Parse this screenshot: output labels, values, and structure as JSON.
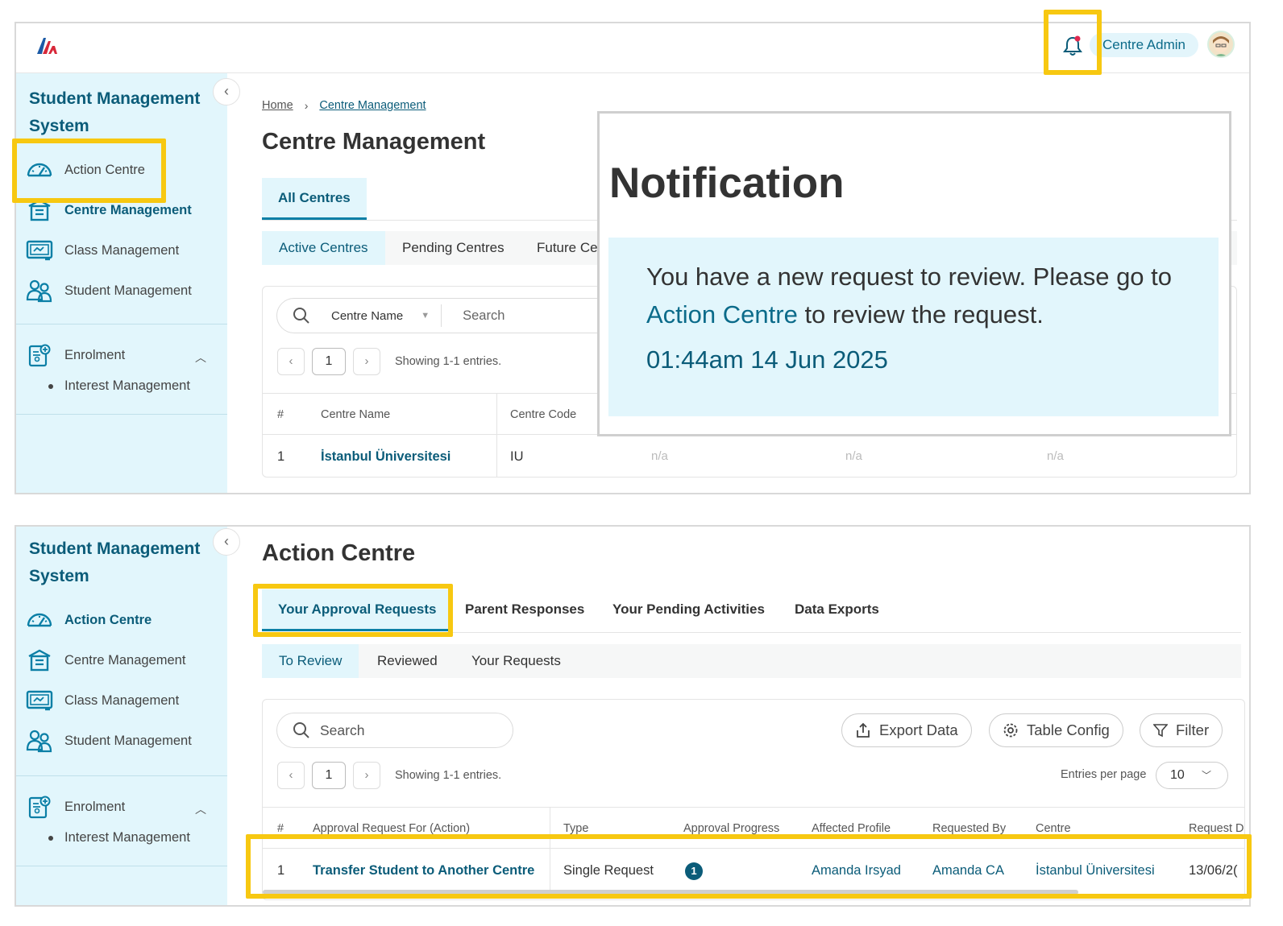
{
  "colors": {
    "brand": "#0b5c79",
    "sidebar_bg": "#e2f6fc",
    "highlight": "#f7c811",
    "notification_dot": "#e0284f"
  },
  "top": {
    "header": {
      "user_name": "Centre Admin"
    },
    "sidebar": {
      "title": "Student Management System",
      "items": [
        {
          "label": "Action Centre",
          "icon": "gauge-icon"
        },
        {
          "label": "Centre Management",
          "icon": "building-icon"
        },
        {
          "label": "Class Management",
          "icon": "classroom-icon"
        },
        {
          "label": "Student Management",
          "icon": "students-icon"
        }
      ],
      "enrolment": {
        "label": "Enrolment",
        "sub_items": [
          "Interest Management"
        ]
      }
    },
    "breadcrumb": [
      "Home",
      "Centre Management"
    ],
    "page_title": "Centre Management",
    "tabs": [
      "All Centres"
    ],
    "subtabs": [
      "Active Centres",
      "Pending Centres",
      "Future Ce"
    ],
    "search": {
      "filter_field": "Centre Name",
      "placeholder": "Search"
    },
    "pager": {
      "page": "1",
      "info": "Showing 1-1 entries."
    },
    "table": {
      "headers": [
        "#",
        "Centre Name",
        "Centre Code"
      ],
      "rows": [
        {
          "num": "1",
          "name": "İstanbul Üniversitesi",
          "code": "IU",
          "c4": "n/a",
          "c5": "n/a",
          "c6": "n/a"
        }
      ]
    },
    "notification": {
      "title": "Notification",
      "message_pre": "You have a new request to review. Please go to ",
      "message_link": "Action Centre",
      "message_post": " to review the request.",
      "time": "01:44am 14 Jun 2025"
    }
  },
  "bottom": {
    "sidebar": {
      "title": "Student Management System",
      "items": [
        {
          "label": "Action Centre",
          "icon": "gauge-icon"
        },
        {
          "label": "Centre Management",
          "icon": "building-icon"
        },
        {
          "label": "Class Management",
          "icon": "classroom-icon"
        },
        {
          "label": "Student Management",
          "icon": "students-icon"
        }
      ],
      "enrolment": {
        "label": "Enrolment",
        "sub_items": [
          "Interest Management"
        ]
      }
    },
    "page_title": "Action Centre",
    "tabs": [
      "Your Approval Requests",
      "Parent Responses",
      "Your Pending Activities",
      "Data Exports"
    ],
    "subtabs": [
      "To Review",
      "Reviewed",
      "Your Requests"
    ],
    "search": {
      "placeholder": "Search"
    },
    "toolbar": {
      "export": "Export Data",
      "table_config": "Table Config",
      "filter": "Filter"
    },
    "pager": {
      "page": "1",
      "info": "Showing 1-1 entries.",
      "entries_label": "Entries per page",
      "entries_value": "10"
    },
    "table": {
      "headers": [
        "#",
        "Approval Request For (Action)",
        "Type",
        "Approval Progress",
        "Affected Profile",
        "Requested By",
        "Centre",
        "Request D"
      ],
      "rows": [
        {
          "num": "1",
          "action": "Transfer Student to Another Centre",
          "type": "Single Request",
          "progress": "1",
          "affected": "Amanda Irsyad",
          "requested_by": "Amanda CA",
          "centre": "İstanbul Üniversitesi",
          "date": "13/06/2("
        }
      ]
    }
  }
}
